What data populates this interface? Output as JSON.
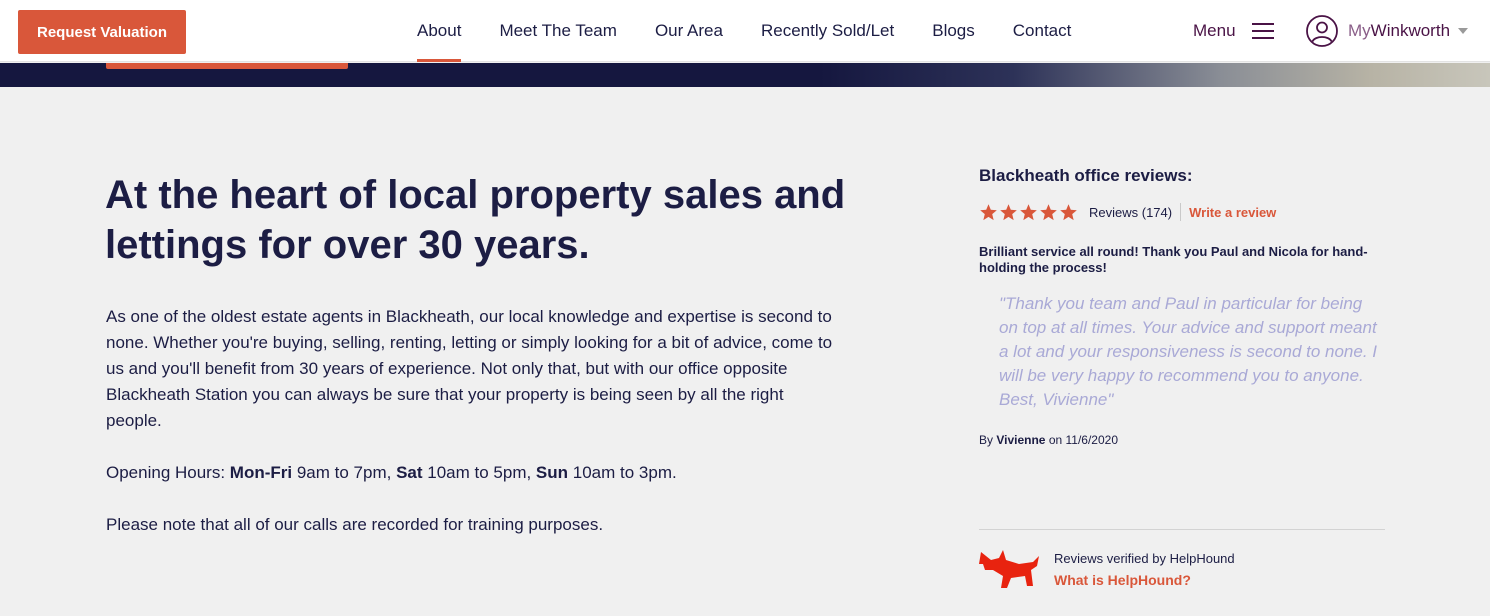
{
  "header": {
    "request_valuation": "Request Valuation",
    "nav": [
      {
        "label": "About",
        "active": true
      },
      {
        "label": "Meet The Team"
      },
      {
        "label": "Our Area"
      },
      {
        "label": "Recently Sold/Let"
      },
      {
        "label": "Blogs"
      },
      {
        "label": "Contact"
      }
    ],
    "menu_label": "Menu",
    "account_prefix": "My",
    "account_name": "Winkworth"
  },
  "main": {
    "headline": "At the heart of local property sales and lettings for over 30 years.",
    "intro": "As one of the oldest estate agents in Blackheath, our local knowledge and expertise is second to none. Whether you're buying, selling, renting, letting or simply looking for a bit of advice, come to us and you'll benefit from 30 years of experience. Not only that, but with our office opposite Blackheath Station you can always be sure that your property is being seen by all the right people.",
    "hours": {
      "prefix": "Opening Hours: ",
      "mon_fri_label": "Mon-Fri",
      "mon_fri": " 9am to 7pm, ",
      "sat_label": "Sat",
      "sat": " 10am to 5pm, ",
      "sun_label": "Sun",
      "sun": " 10am to 3pm."
    },
    "note": "Please note that all of our calls are recorded for training purposes."
  },
  "reviews": {
    "title": "Blackheath office reviews:",
    "rating": 5,
    "count_label": "Reviews (174)",
    "write_review": "Write a review",
    "review_title": "Brilliant service all round! Thank you Paul and Nicola for hand-holding the process!",
    "quote": "\"Thank you team and Paul in particular for being on top at all times. Your advice and support meant a lot and your responsiveness is second to none. I will be very happy to recommend you to anyone. Best, Vivienne\"",
    "author_prefix": "By ",
    "author": "Vivienne",
    "date": " on 11/6/2020",
    "verified_by": "Reviews verified by HelpHound",
    "helphound_link": "What is HelpHound?"
  },
  "colors": {
    "accent": "#d9573a",
    "navy": "#1c1d44",
    "plum": "#4a1346",
    "quote": "#a9a9d6",
    "background": "#f0f0f0"
  }
}
